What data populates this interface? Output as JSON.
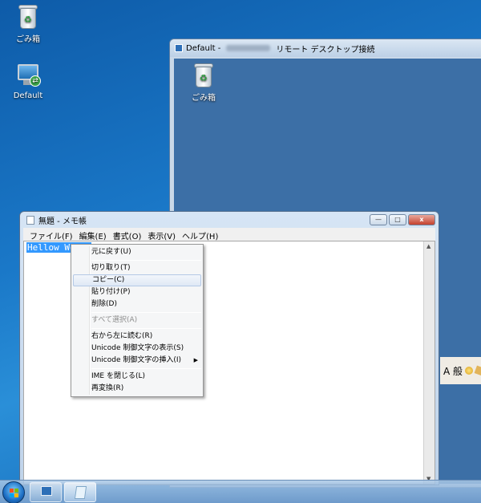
{
  "desktop": {
    "icons": [
      {
        "label": "ごみ箱",
        "icon": "recycle-bin-icon"
      },
      {
        "label": "Default",
        "icon": "remote-desktop-shortcut-icon"
      }
    ]
  },
  "rdp_window": {
    "title_prefix": "Default -",
    "title_suffix": "リモート デスクトップ接続",
    "remote_icons": [
      {
        "label": "ごみ箱",
        "icon": "recycle-bin-icon"
      }
    ],
    "tray_text": "A 般"
  },
  "notepad": {
    "title": "無題 - メモ帳",
    "menu": [
      "ファイル(F)",
      "編集(E)",
      "書式(O)",
      "表示(V)",
      "ヘルプ(H)"
    ],
    "content": "Hellow World",
    "controls": {
      "minimize": "—",
      "maximize": "□",
      "close": "x"
    }
  },
  "context_menu": {
    "items": [
      {
        "label": "元に戻す(U)",
        "enabled": true
      },
      {
        "separator": true
      },
      {
        "label": "切り取り(T)",
        "enabled": true
      },
      {
        "label": "コピー(C)",
        "enabled": true,
        "highlighted": true
      },
      {
        "label": "貼り付け(P)",
        "enabled": true
      },
      {
        "label": "削除(D)",
        "enabled": true
      },
      {
        "separator": true
      },
      {
        "label": "すべて選択(A)",
        "enabled": false
      },
      {
        "separator": true
      },
      {
        "label": "右から左に読む(R)",
        "enabled": true
      },
      {
        "label": "Unicode 制御文字の表示(S)",
        "enabled": true
      },
      {
        "label": "Unicode 制御文字の挿入(I)",
        "enabled": true,
        "submenu": true
      },
      {
        "separator": true
      },
      {
        "label": "IME を閉じる(L)",
        "enabled": true
      },
      {
        "label": "再変換(R)",
        "enabled": true
      }
    ]
  },
  "taskbar": {
    "buttons": [
      {
        "name": "start",
        "icon": "windows-logo-icon"
      },
      {
        "name": "remote-desktop",
        "icon": "remote-desktop-icon"
      },
      {
        "name": "notepad",
        "icon": "notepad-icon",
        "active": true
      }
    ]
  }
}
